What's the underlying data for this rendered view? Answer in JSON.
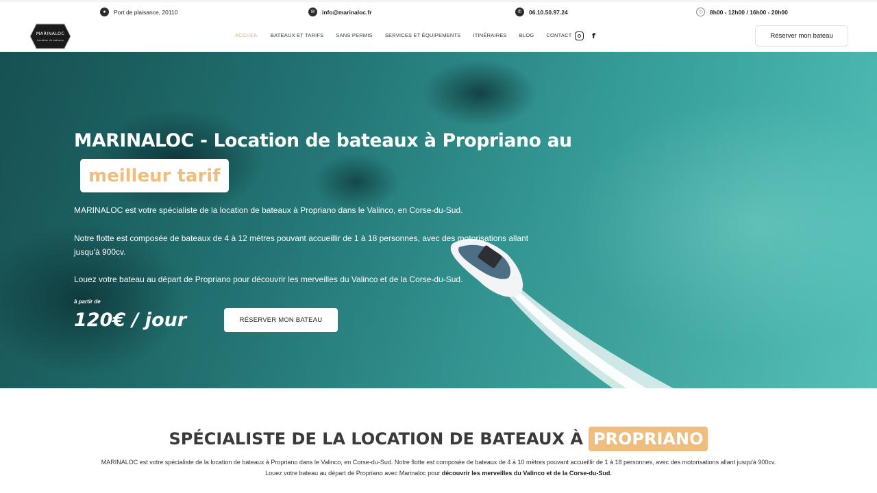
{
  "topbar": {
    "address": "Port de plaisance, 20110",
    "email": "info@marinaloc.fr",
    "phone": "06.10.50.97.24",
    "hours": "8h00 - 12h00 / 16h00 - 20h00",
    "icons": [
      "location-pin-icon",
      "mail-icon",
      "phone-icon",
      "clock-icon"
    ]
  },
  "logo": {
    "name": "MARINALOC",
    "tagline": "Location de bateaux"
  },
  "nav": {
    "items": [
      "ACCUEIL",
      "BATEAUX ET TARIFS",
      "SANS PERMIS",
      "SERVICES ET ÉQUIPEMENTS",
      "ITINÉRAIRES",
      "BLOG",
      "CONTACT"
    ],
    "active": "ACCUEIL",
    "social": [
      "instagram-icon",
      "facebook-icon"
    ],
    "cta": "Réserver mon bateau"
  },
  "hero": {
    "title": "MARINALOC - Location de bateaux à Propriano au",
    "highlight": "meilleur tarif",
    "p1": "MARINALOC est votre spécialiste de la location de bateaux à Propriano dans le Valinco, en Corse-du-Sud.",
    "p2": "Notre flotte est composée de bateaux de 4 à 12 mètres pouvant accueillir de 1 à 18 personnes, avec des motorisations allant jusqu'à 900cv.",
    "p3": "Louez votre bateau au départ de Propriano pour découvrir les merveilles du Valinco et de la Corse-du-Sud.",
    "price_prefix": "à partir de",
    "price": "120€ / jour",
    "cta": "RÉSERVER MON BATEAU"
  },
  "section": {
    "title": "SPÉCIALISTE DE LA LOCATION DE BATEAUX À",
    "title_highlight": "PROPRIANO",
    "text": "MARINALOC est votre spécialiste de la location de bateaux à Propriano dans le Valinco, en Corse-du-Sud. Notre flotte est composée de bateaux de 4 à 10 mètres pouvant accueillir de 1 à 18 personnes, avec des motorisations allant jusqu'à 900cv. Louez votre bateau au départ de Propriano avec Marinaloc pour",
    "text_bold": "découvrir les merveilles du Valinco et de la Corse-du-Sud."
  },
  "colors": {
    "accent": "#efbd7d",
    "nav_active": "#e9b070",
    "text_dark": "#3a3a3a"
  }
}
